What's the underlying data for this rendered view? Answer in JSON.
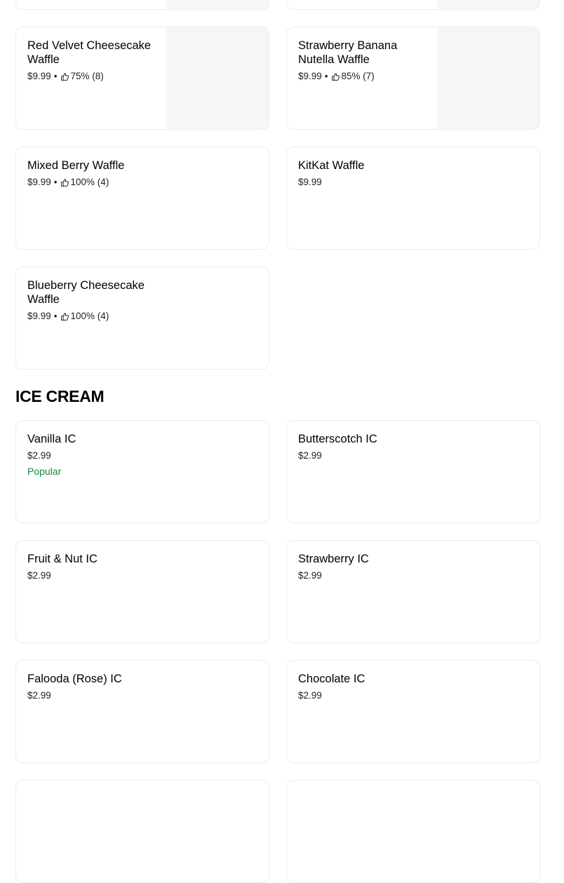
{
  "waffles": [
    {
      "name": "Red Velvet Cheesecake Waffle",
      "price": "$9.99",
      "rating": "75% (8)"
    },
    {
      "name": "Strawberry Banana Nutella Waffle",
      "price": "$9.99",
      "rating": "85% (7)"
    },
    {
      "name": "Mixed Berry Waffle",
      "price": "$9.99",
      "rating": "100% (4)"
    },
    {
      "name": "KitKat Waffle",
      "price": "$9.99"
    },
    {
      "name": "Blueberry Cheesecake Waffle",
      "price": "$9.99",
      "rating": "100% (4)"
    }
  ],
  "ice_cream_section": {
    "title": "ICE CREAM",
    "items": [
      {
        "name": "Vanilla IC",
        "price": "$2.99",
        "badge": "Popular"
      },
      {
        "name": "Butterscotch IC",
        "price": "$2.99"
      },
      {
        "name": "Fruit & Nut IC",
        "price": "$2.99"
      },
      {
        "name": "Strawberry IC",
        "price": "$2.99"
      },
      {
        "name": "Falooda (Rose) IC",
        "price": "$2.99"
      },
      {
        "name": "Chocolate IC",
        "price": "$2.99"
      }
    ]
  },
  "meta": {
    "separator": "•"
  },
  "colors": {
    "popular": "#118a3a",
    "card_border": "#ececec",
    "thumb_bg": "#f6f6f6"
  },
  "icons": {
    "rating": "thumbs-up-icon"
  }
}
